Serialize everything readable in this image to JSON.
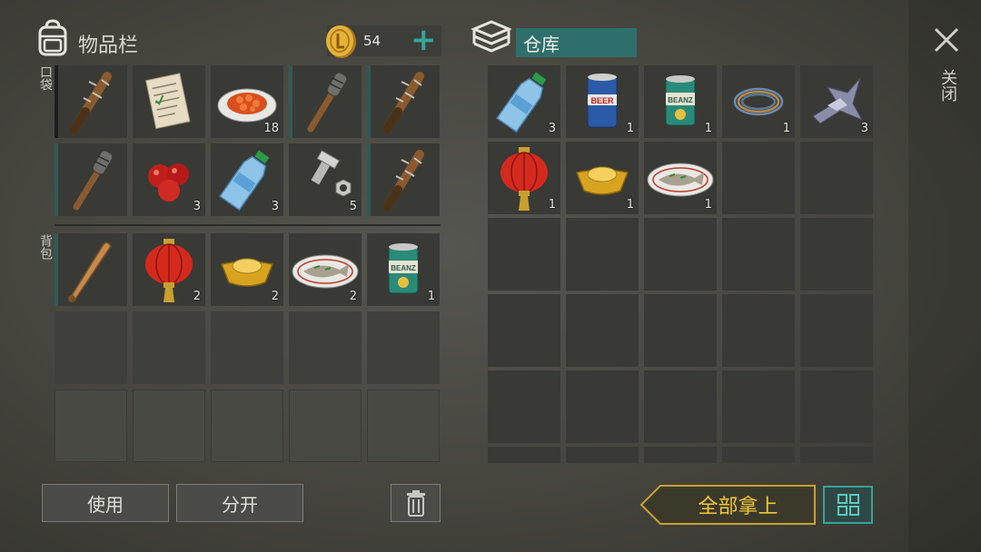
{
  "inventory": {
    "title": "物品栏",
    "coins": "54",
    "add_symbol": "+",
    "pocket_label": "口袋",
    "backpack_label": "背包",
    "pocket_slots": [
      {
        "icon": "spiked-bat",
        "qty": "",
        "bar": false
      },
      {
        "icon": "note-paper",
        "qty": "",
        "bar": false
      },
      {
        "icon": "food-plate",
        "qty": "18",
        "bar": false
      },
      {
        "icon": "nail-club",
        "qty": "",
        "bar": true
      },
      {
        "icon": "spiked-bat",
        "qty": "",
        "bar": true
      },
      {
        "icon": "nail-club",
        "qty": "",
        "bar": true
      },
      {
        "icon": "tomatoes",
        "qty": "3",
        "bar": false
      },
      {
        "icon": "water-bottle",
        "qty": "3",
        "bar": false
      },
      {
        "icon": "bolt-nut",
        "qty": "5",
        "bar": false
      },
      {
        "icon": "spiked-bat",
        "qty": "",
        "bar": true
      }
    ],
    "backpack_slots": [
      {
        "icon": "baseball-bat",
        "qty": "",
        "bar": true
      },
      {
        "icon": "red-lantern",
        "qty": "2",
        "bar": false
      },
      {
        "icon": "gold-ingot",
        "qty": "2",
        "bar": false
      },
      {
        "icon": "fish-plate",
        "qty": "2",
        "bar": false
      },
      {
        "icon": "bean-can",
        "qty": "1",
        "bar": false
      }
    ]
  },
  "storage": {
    "title": "仓库",
    "slots": [
      {
        "icon": "water-bottle",
        "qty": "3"
      },
      {
        "icon": "beer-can",
        "qty": "1"
      },
      {
        "icon": "bean-can",
        "qty": "1"
      },
      {
        "icon": "wire-coil",
        "qty": "1"
      },
      {
        "icon": "metal-scrap",
        "qty": "3"
      },
      {
        "icon": "red-lantern",
        "qty": "1"
      },
      {
        "icon": "gold-ingot",
        "qty": "1"
      },
      {
        "icon": "fish-plate",
        "qty": "1"
      }
    ]
  },
  "close_label": "关闭",
  "buttons": {
    "use": "使用",
    "split": "分开",
    "take_all": "全部拿上"
  },
  "labels": {
    "beer": "BEER",
    "beanz": "BEANZ"
  },
  "colors": {
    "teal": "#2f6f6b",
    "gold": "#c8a030",
    "gold_text": "#f1c83a"
  }
}
